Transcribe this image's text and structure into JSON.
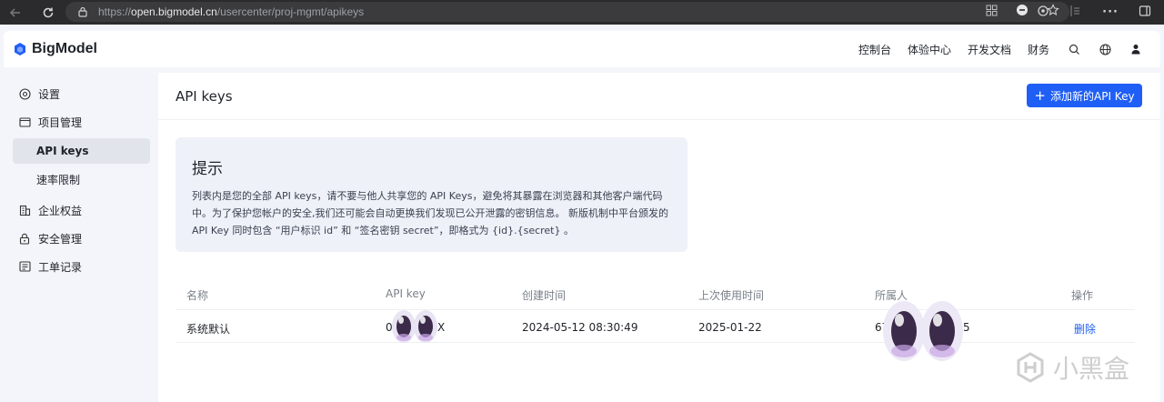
{
  "browser": {
    "url_prefix": "https://",
    "url_host": "open.bigmodel.cn",
    "url_path": "/usercenter/proj-mgmt/apikeys",
    "url_icons": [
      "grid-icon",
      "reader-icon",
      "star-icon"
    ],
    "right_icons": [
      "extensions-icon",
      "profile-icon",
      "more-icon",
      "edge-sidebar-icon"
    ],
    "more_label": "···"
  },
  "header": {
    "brand": "BigModel",
    "brand_color": "#1f5ff5",
    "nav": [
      "控制台",
      "体验中心",
      "开发文档",
      "财务"
    ],
    "icons": [
      "search-icon",
      "globe-icon",
      "user-icon"
    ]
  },
  "sidebar": {
    "items": [
      {
        "label": "设置",
        "icon": "settings-icon"
      },
      {
        "label": "项目管理",
        "icon": "folder-icon"
      },
      {
        "label": "API keys",
        "icon": ""
      },
      {
        "label": "速率限制",
        "icon": ""
      },
      {
        "label": "企业权益",
        "icon": "building-icon"
      },
      {
        "label": "安全管理",
        "icon": "lock-icon"
      },
      {
        "label": "工单记录",
        "icon": "ticket-icon"
      }
    ]
  },
  "main": {
    "title": "API keys",
    "add_button": "添加新的API Key",
    "tip": {
      "title": "提示",
      "text": "列表内是您的全部 API keys，请不要与他人共享您的 API Keys，避免将其暴露在浏览器和其他客户端代码中。为了保护您帐户的安全,我们还可能会自动更换我们发现已公开泄露的密钥信息。 新版机制中平台颁发的 API Key 同时包含 “用户标识 id” 和 “签名密钥 secret”，即格式为 {id}.{secret} 。"
    },
    "table": {
      "headers": [
        "名称",
        "API key",
        "创建时间",
        "上次使用时间",
        "所属人",
        "操作"
      ],
      "rows": [
        {
          "name": "系统默认",
          "key_start": "0",
          "key_end": "X",
          "created": "2024-05-12 08:30:49",
          "last_used": "2025-01-22",
          "owner_start": "67",
          "owner_end": "5",
          "action": "删除"
        }
      ]
    }
  },
  "watermark": "小黑盒"
}
